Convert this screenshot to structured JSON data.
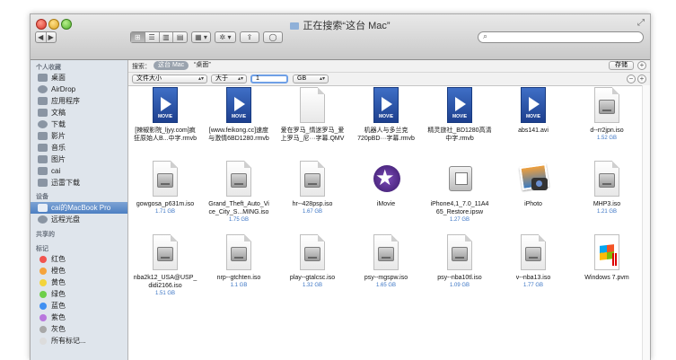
{
  "window": {
    "title": "正在搜索“这台 Mac”"
  },
  "toolbar": {
    "back": "◀",
    "forward": "▶",
    "view_icon": "⊞",
    "view_list": "☰",
    "view_column": "▥",
    "view_cover": "▤",
    "arrange": "▦ ▾",
    "action": "✲ ▾",
    "share": "⇪",
    "tag": "◯"
  },
  "searchbar": {
    "label": "搜索：",
    "scope_this_mac": "这台 Mac",
    "scope_folder": "“桌面”",
    "save_button": "存储"
  },
  "filter": {
    "attribute": "文件大小",
    "operator": "大于",
    "value": "1",
    "unit": "GB"
  },
  "sidebar": {
    "favorites_header": "个人收藏",
    "favorites": [
      {
        "label": "桌面",
        "icon": "desktop-icon"
      },
      {
        "label": "AirDrop",
        "icon": "airdrop-icon"
      },
      {
        "label": "应用程序",
        "icon": "applications-icon"
      },
      {
        "label": "文稿",
        "icon": "documents-icon"
      },
      {
        "label": "下载",
        "icon": "downloads-icon"
      },
      {
        "label": "影片",
        "icon": "movies-icon"
      },
      {
        "label": "音乐",
        "icon": "music-icon"
      },
      {
        "label": "图片",
        "icon": "pictures-icon"
      },
      {
        "label": "cai",
        "icon": "home-icon"
      },
      {
        "label": "迅雷下载",
        "icon": "folder-icon"
      }
    ],
    "devices_header": "设备",
    "devices": [
      {
        "label": "cai的MacBook Pro",
        "icon": "laptop-icon"
      },
      {
        "label": "远程光盘",
        "icon": "disc-icon"
      }
    ],
    "shared_header": "共享的",
    "tags_header": "标记",
    "tags": [
      {
        "label": "红色",
        "color": "#f2544f"
      },
      {
        "label": "橙色",
        "color": "#f5a33c"
      },
      {
        "label": "黄色",
        "color": "#f3d43b"
      },
      {
        "label": "绿色",
        "color": "#6dcf4a"
      },
      {
        "label": "蓝色",
        "color": "#3f8ff2"
      },
      {
        "label": "紫色",
        "color": "#b977dd"
      },
      {
        "label": "灰色",
        "color": "#a8a8a8"
      },
      {
        "label": "所有标记...",
        "color": "#dcdcdc"
      }
    ]
  },
  "files": [
    {
      "name1": "[辣椒影院_ljyy.com]疯",
      "name2": "狂原始人B...中字.rmvb",
      "size": "",
      "type": "movie"
    },
    {
      "name1": "[www.feikong.cc]速度",
      "name2": "与激情6BD1280.rmvb",
      "size": "",
      "type": "movie"
    },
    {
      "name1": "爱在罗马_情迷罗马_爱",
      "name2": "上罗马_尼···字幕.QMV",
      "size": "",
      "type": "blank"
    },
    {
      "name1": "机器人与多兰克",
      "name2": "720pBD···字幕.rmvb",
      "size": "",
      "type": "movie"
    },
    {
      "name1": "精灵旅社_BD1280高清",
      "name2": "中字.rmvb",
      "size": "",
      "type": "movie"
    },
    {
      "name1": "abs141.avi",
      "name2": "",
      "size": "",
      "type": "movie"
    },
    {
      "name1": "d--rr2jpn.iso",
      "name2": "",
      "size": "1.52 GB",
      "type": "iso"
    },
    {
      "name1": "gowgosa_p631m.iso",
      "name2": "",
      "size": "1.71 GB",
      "type": "iso"
    },
    {
      "name1": "Grand_Theft_Auto_Vi",
      "name2": "ce_City_S...MING.iso",
      "size": "1.75 GB",
      "type": "iso"
    },
    {
      "name1": "hr--428psp.iso",
      "name2": "",
      "size": "1.67 GB",
      "type": "iso"
    },
    {
      "name1": "iMovie",
      "name2": "",
      "size": "",
      "type": "imovie"
    },
    {
      "name1": "iPhone4,1_7.0_11A4",
      "name2": "65_Restore.ipsw",
      "size": "1.27 GB",
      "type": "installer"
    },
    {
      "name1": "iPhoto",
      "name2": "",
      "size": "",
      "type": "iphoto"
    },
    {
      "name1": "MHP3.iso",
      "name2": "",
      "size": "1.21 GB",
      "type": "iso"
    },
    {
      "name1": "nba2k12_USA@USP_",
      "name2": "didi2166.iso",
      "size": "1.51 GB",
      "type": "iso"
    },
    {
      "name1": "nrp--gtchten.iso",
      "name2": "",
      "size": "1.1 GB",
      "type": "iso"
    },
    {
      "name1": "play--gtalcsc.iso",
      "name2": "",
      "size": "1.32 GB",
      "type": "iso"
    },
    {
      "name1": "psy--mgspw.iso",
      "name2": "",
      "size": "1.65 GB",
      "type": "iso"
    },
    {
      "name1": "psy--nba10tl.iso",
      "name2": "",
      "size": "1.09 GB",
      "type": "iso"
    },
    {
      "name1": "v--nba13.iso",
      "name2": "",
      "size": "1.77 GB",
      "type": "iso"
    },
    {
      "name1": "Windows 7.pvm",
      "name2": "",
      "size": "",
      "type": "pvm"
    }
  ]
}
